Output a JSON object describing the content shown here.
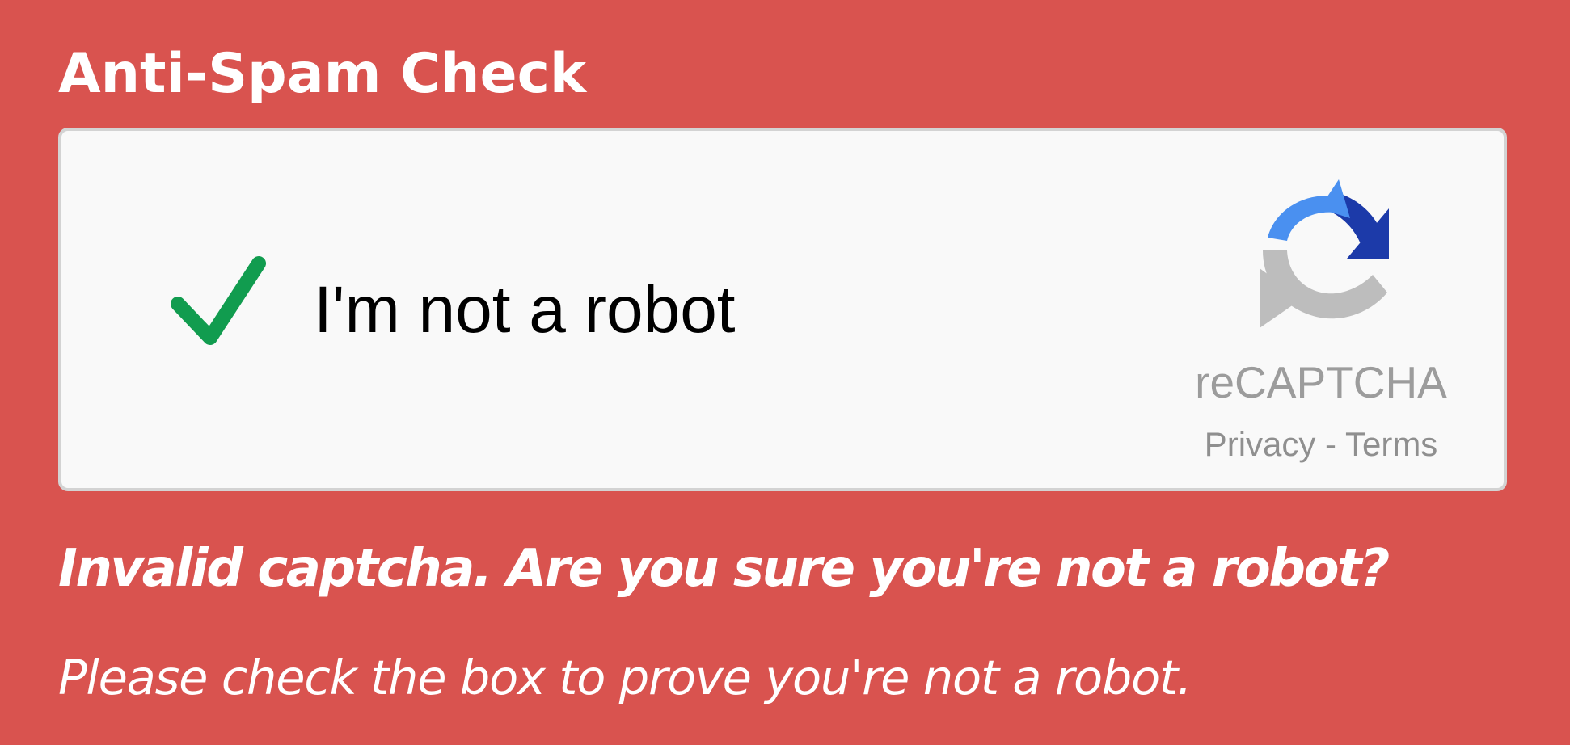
{
  "form": {
    "heading": "Anti-Spam Check"
  },
  "captcha": {
    "checked": true,
    "checkbox_label": "I'm not a robot",
    "checkmark_icon": "check-icon",
    "logo_icon": "recaptcha-logo-icon",
    "brand_name": "reCAPTCHA",
    "privacy_link": "Privacy",
    "separator": " - ",
    "terms_link": "Terms"
  },
  "error": {
    "title": "Invalid captcha. Are you sure you're not a robot?",
    "help": "Please check the box to prove you're not a robot."
  },
  "colors": {
    "page_background": "#d9534f",
    "check_green": "#119c4f",
    "logo_light_blue": "#4a90f0",
    "logo_dark_blue": "#1c3aa9",
    "logo_gray": "#bdbdbd"
  }
}
